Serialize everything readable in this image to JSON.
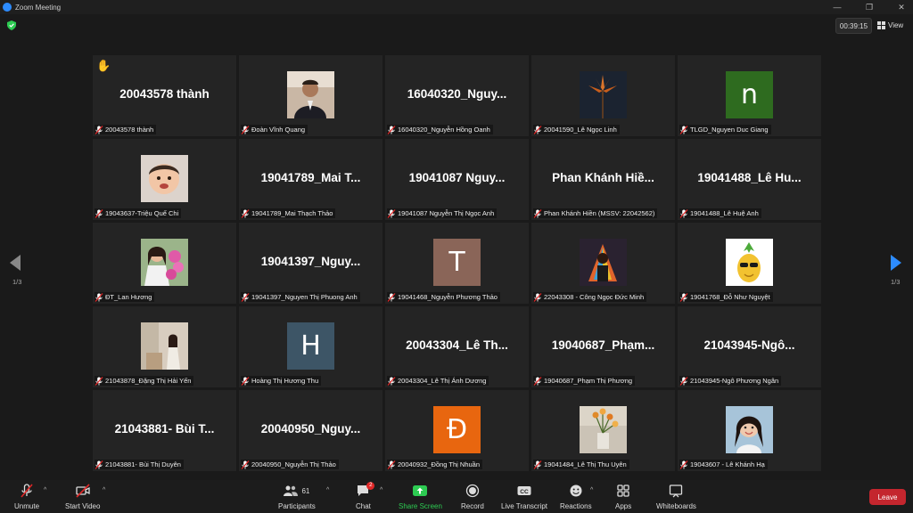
{
  "window": {
    "title": "Zoom Meeting",
    "minimize": "—",
    "maximize": "❐",
    "close": "✕"
  },
  "header": {
    "timer": "00:39:15",
    "view_label": "View"
  },
  "pagination": {
    "left": "1/3",
    "right": "1/3"
  },
  "tiles": [
    {
      "big": "20043578 thành",
      "label": "20043578 thành",
      "hand": "✋"
    },
    {
      "photo": "man-suit",
      "label": "Đoàn Vĩnh Quang"
    },
    {
      "big": "16040320_Nguy...",
      "label": "16040320_Nguyễn Hồng Oanh"
    },
    {
      "photo": "dark-flower",
      "label": "20041590_Lê Ngọc Linh"
    },
    {
      "avatar": "n",
      "avatar_color": "#2e6b1f",
      "label": "TLGD_Nguyen Duc Giang"
    },
    {
      "photo": "baby",
      "label": "19043637-Triệu Quế Chi"
    },
    {
      "big": "19041789_Mai  T...",
      "label": "19041789_Mai Thạch Thảo"
    },
    {
      "big": "19041087  Nguy...",
      "label": "19041087 Nguyễn Thị Ngọc Anh"
    },
    {
      "big": "Phan  Khánh  Hiề...",
      "label": "Phan Khánh Hiền (MSSV: 22042562)"
    },
    {
      "big": "19041488_Lê  Hu...",
      "label": "19041488_Lê Huệ Anh"
    },
    {
      "photo": "girl-pink",
      "label": "ĐT_Lan Hương"
    },
    {
      "big": "19041397_Nguy...",
      "label": "19041397_Nguyen Thị Phuong Anh"
    },
    {
      "avatar": "T",
      "avatar_color": "#8a6558",
      "label": "19041468_Nguyễn Phương Thảo"
    },
    {
      "photo": "colorful-art",
      "label": "22043308 - Công Ngọc Đức Minh"
    },
    {
      "photo": "pineapple",
      "label": "19041768_Đỗ Như Nguyệt"
    },
    {
      "photo": "girl-room",
      "label": "21043878_Đặng Thị Hải Yến"
    },
    {
      "avatar": "H",
      "avatar_color": "#3d5566",
      "label": "Hoàng Thị Hương Thu"
    },
    {
      "big": "20043304_Lê  Th...",
      "label": "20043304_Lê Thị Ánh Dương"
    },
    {
      "big": "19040687_Phạm...",
      "label": "19040687_Phạm Thị Phương"
    },
    {
      "big": "21043945-Ngô...",
      "label": "21043945-Ngô Phương Ngân"
    },
    {
      "big": "21043881-  Bùi  T...",
      "label": "21043881- Bùi Thị Duyên"
    },
    {
      "big": "20040950_Nguy...",
      "label": "20040950_Nguyễn Thị Thảo"
    },
    {
      "avatar": "Đ",
      "avatar_color": "#e8660f",
      "label": "20040932_Đồng Thị Nhuần"
    },
    {
      "photo": "flowers-vase",
      "label": "19041484_Lê Thị Thu Uyên"
    },
    {
      "photo": "girl-smile",
      "label": "19043607 - Lê Khánh Hạ"
    }
  ],
  "toolbar": {
    "unmute": "Unmute",
    "start_video": "Start Video",
    "participants": "Participants",
    "participants_count": "61",
    "chat": "Chat",
    "chat_badge": "2",
    "share_screen": "Share Screen",
    "record": "Record",
    "live_transcript": "Live Transcript",
    "reactions": "Reactions",
    "apps": "Apps",
    "whiteboards": "Whiteboards",
    "leave": "Leave"
  },
  "colors": {
    "share_green": "#2dcb52",
    "leave_red": "#c4262e",
    "arrow_blue": "#2d8cff"
  }
}
